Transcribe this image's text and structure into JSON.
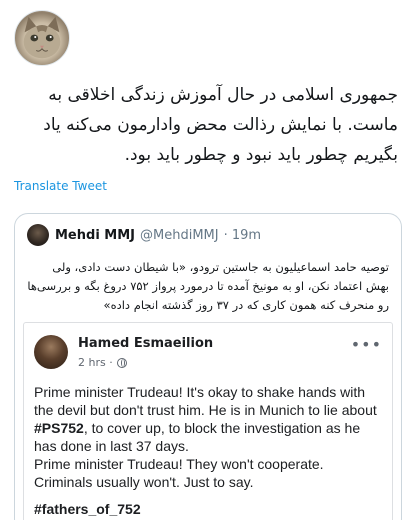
{
  "tweet": {
    "avatar_icon": "cat-avatar-icon",
    "text": "جمهوری اسلامی در حال آموزش زندگی اخلاقی به ماست. با نمایش رذالت محض وادارمون می‌کنه یاد بگیریم چطور باید نبود و چطور باید بود.",
    "translate_label": "Translate Tweet"
  },
  "quote": {
    "name": "Mehdi MMJ",
    "handle": "@MehdiMMJ",
    "time": "· 19m",
    "text": "توصیه حامد اسماعیلیون به جاستین ترودو، «با شیطان دست دادی، ولی بهش اعتماد نکن، او به مونیخ آمده تا درمورد پرواز ۷۵۲ دروغ بگه و بررسی‌ها رو منحرف کنه همون کاری که در ۳۷ روز گذشته انجام داده»",
    "embedded_post": {
      "author": "Hamed Esmaeilion",
      "time": "2 hrs ·",
      "more_label": "•••",
      "line1_pre": "Prime minister Trudeau! It's okay to shake hands with the devil but don't trust him. He is in Munich to lie about ",
      "line1_tag": "#PS752",
      "line1_post": ", to cover up, to block the investigation as he has done in last 37 days.",
      "line2": "Prime minister Trudeau! They won't cooperate. Criminals usually won't. Just to say.",
      "hashtag": "#fathers_of_752"
    }
  },
  "colors": {
    "link": "#1b95e0",
    "muted": "#657786",
    "border": "#ccd6dd"
  }
}
